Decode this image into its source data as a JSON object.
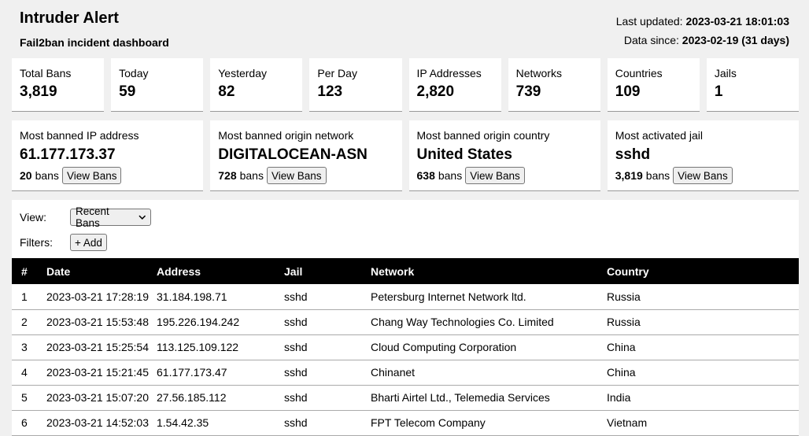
{
  "header": {
    "title": "Intruder Alert",
    "subtitle": "Fail2ban incident dashboard",
    "last_updated_label": "Last updated:",
    "last_updated_value": "2023-03-21 18:01:03",
    "data_since_label": "Data since:",
    "data_since_value": "2023-02-19 (31 days)"
  },
  "stats": [
    {
      "label": "Total Bans",
      "value": "3,819"
    },
    {
      "label": "Today",
      "value": "59"
    },
    {
      "label": "Yesterday",
      "value": "82"
    },
    {
      "label": "Per Day",
      "value": "123"
    },
    {
      "label": "IP Addresses",
      "value": "2,820"
    },
    {
      "label": "Networks",
      "value": "739"
    },
    {
      "label": "Countries",
      "value": "109"
    },
    {
      "label": "Jails",
      "value": "1"
    }
  ],
  "tops": [
    {
      "label": "Most banned IP address",
      "value": "61.177.173.37",
      "count": "20",
      "count_suffix": "bans",
      "button": "View Bans"
    },
    {
      "label": "Most banned origin network",
      "value": "DIGITALOCEAN-ASN",
      "count": "728",
      "count_suffix": "bans",
      "button": "View Bans"
    },
    {
      "label": "Most banned origin country",
      "value": "United States",
      "count": "638",
      "count_suffix": "bans",
      "button": "View Bans"
    },
    {
      "label": "Most activated jail",
      "value": "sshd",
      "count": "3,819",
      "count_suffix": "bans",
      "button": "View Bans"
    }
  ],
  "controls": {
    "view_label": "View:",
    "view_selected": "Recent Bans",
    "filters_label": "Filters:",
    "add_button": "+ Add"
  },
  "table": {
    "columns": [
      "#",
      "Date",
      "Address",
      "Jail",
      "Network",
      "Country"
    ],
    "rows": [
      [
        "1",
        "2023-03-21 17:28:19",
        "31.184.198.71",
        "sshd",
        "Petersburg Internet Network ltd.",
        "Russia"
      ],
      [
        "2",
        "2023-03-21 15:53:48",
        "195.226.194.242",
        "sshd",
        "Chang Way Technologies Co. Limited",
        "Russia"
      ],
      [
        "3",
        "2023-03-21 15:25:54",
        "113.125.109.122",
        "sshd",
        "Cloud Computing Corporation",
        "China"
      ],
      [
        "4",
        "2023-03-21 15:21:45",
        "61.177.173.47",
        "sshd",
        "Chinanet",
        "China"
      ],
      [
        "5",
        "2023-03-21 15:07:20",
        "27.56.185.112",
        "sshd",
        "Bharti Airtel Ltd., Telemedia Services",
        "India"
      ],
      [
        "6",
        "2023-03-21 14:52:03",
        "1.54.42.35",
        "sshd",
        "FPT Telecom Company",
        "Vietnam"
      ]
    ]
  }
}
